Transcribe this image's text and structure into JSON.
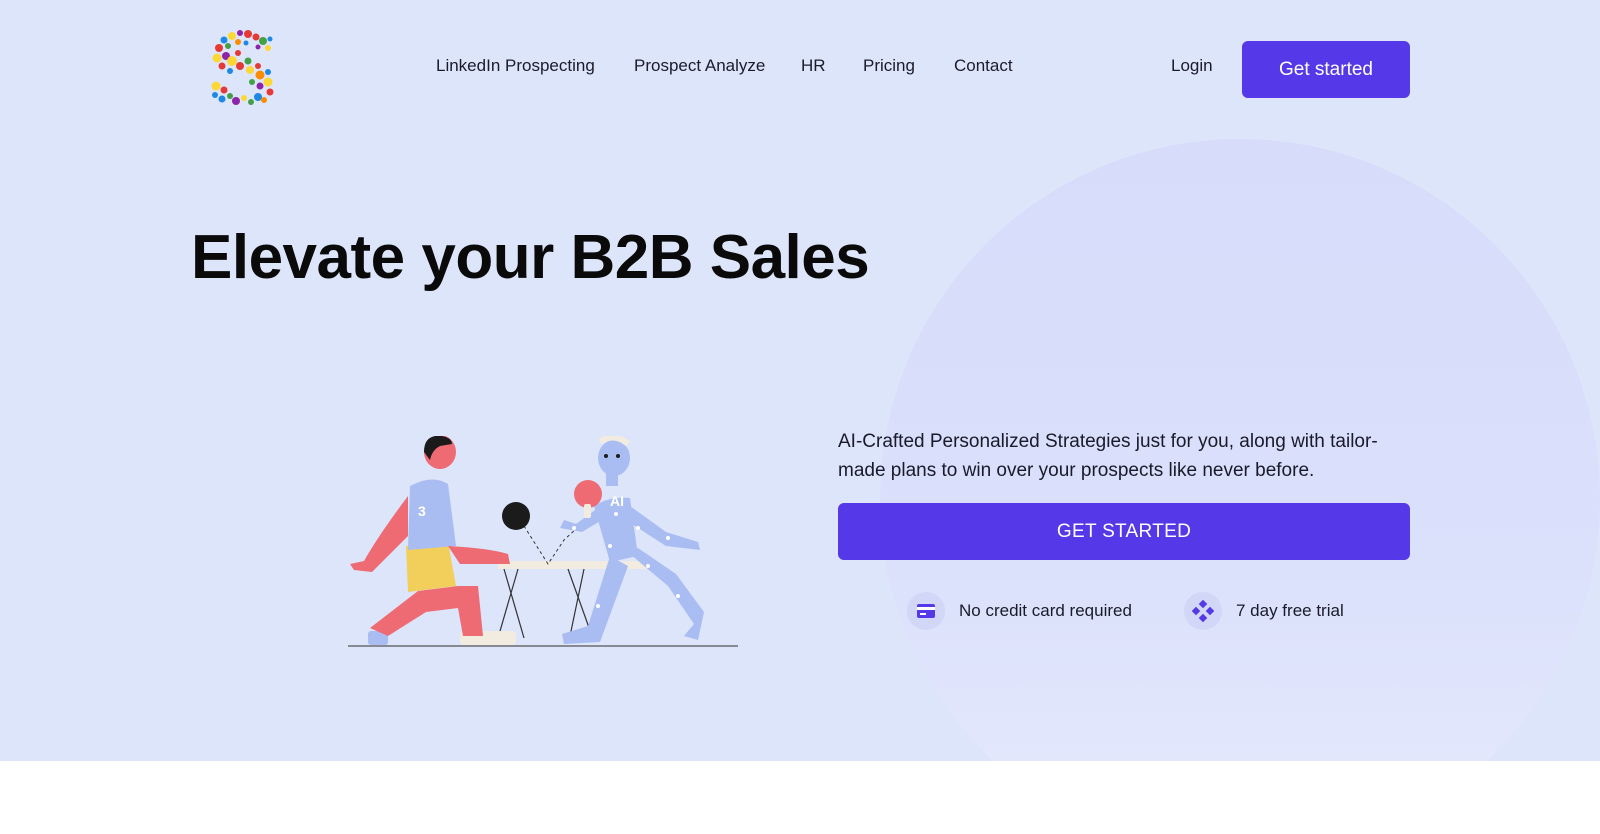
{
  "brand": {
    "logo_icon": "colorful-dotted-s-logo-icon"
  },
  "nav": {
    "items": [
      {
        "label": "LinkedIn Prospecting"
      },
      {
        "label": "Prospect Analyze"
      },
      {
        "label": "HR"
      },
      {
        "label": "Pricing"
      },
      {
        "label": "Contact"
      }
    ],
    "login_label": "Login",
    "get_started_label": "Get started"
  },
  "hero": {
    "headline": "Elevate your B2B Sales",
    "description": "AI-Crafted Personalized Strategies just for you, along with tailor-made plans to win over your prospects like never before.",
    "cta_label": "GET STARTED",
    "illustration_icon": "ping-pong-human-vs-ai-illustration",
    "illustration": {
      "jersey_number": "3",
      "robot_label": "AI"
    },
    "features": [
      {
        "icon": "credit-card-icon",
        "label": "No credit card required"
      },
      {
        "icon": "diamond-dots-icon",
        "label": "7 day free trial"
      }
    ]
  },
  "colors": {
    "accent": "#5538e8",
    "hero_background": "#dde5fb",
    "circle": "#d6dcfa"
  }
}
